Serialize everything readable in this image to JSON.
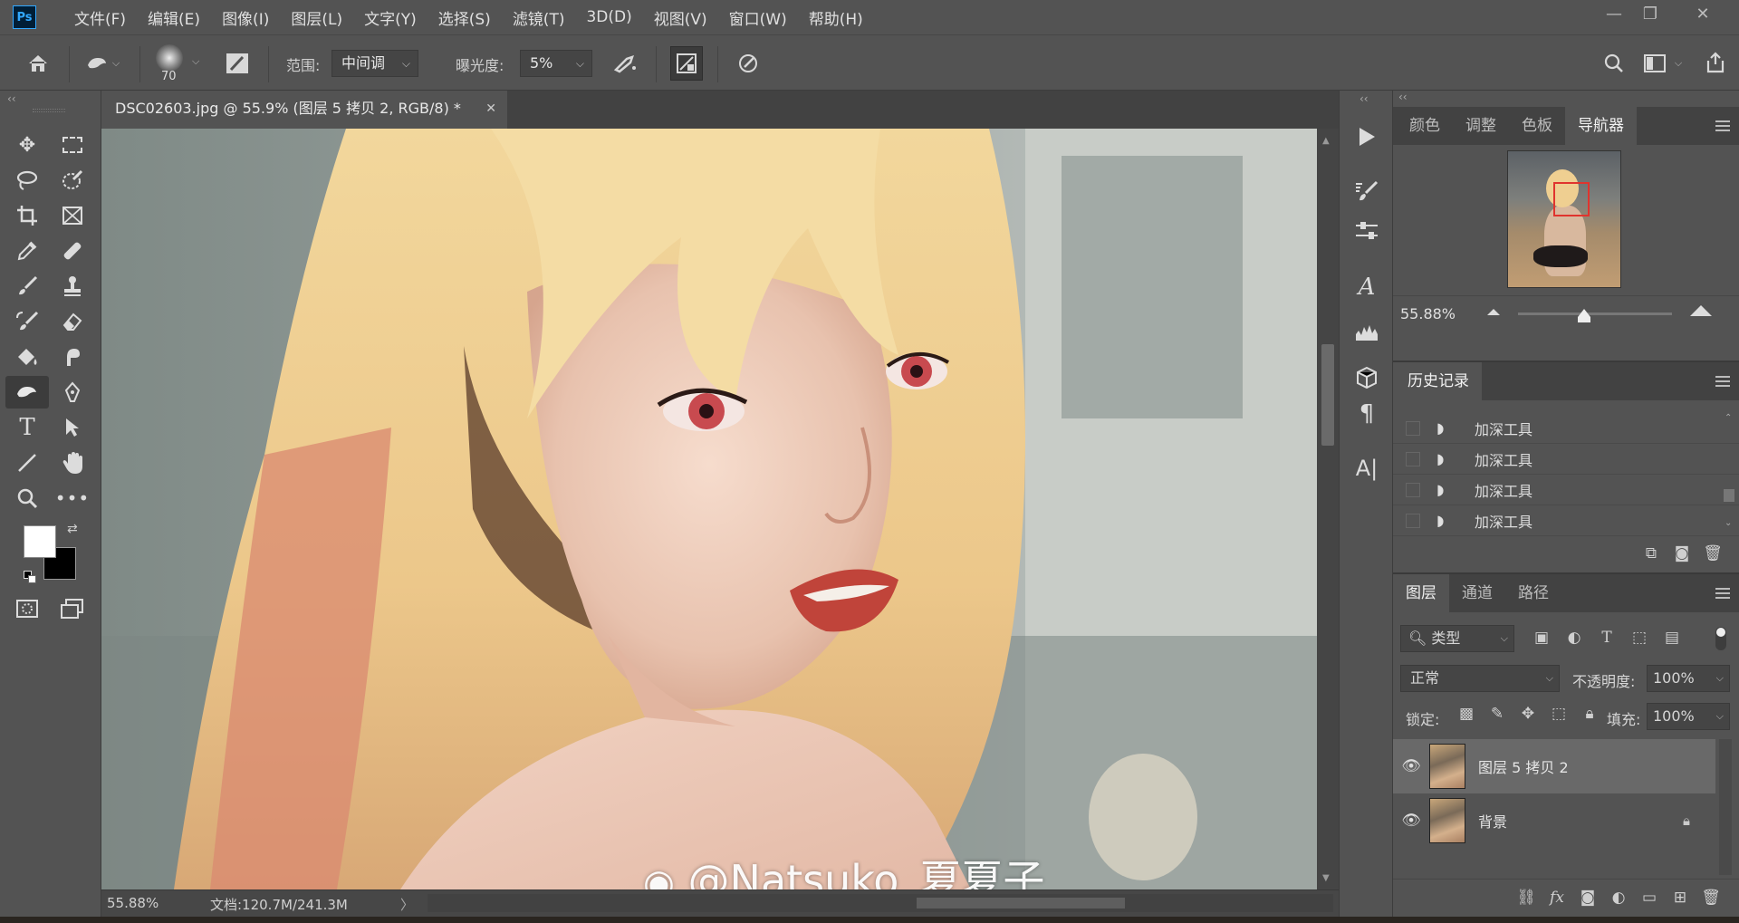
{
  "app": {
    "logo": "Ps"
  },
  "menu": [
    "文件(F)",
    "编辑(E)",
    "图像(I)",
    "图层(L)",
    "文字(Y)",
    "选择(S)",
    "滤镜(T)",
    "3D(D)",
    "视图(V)",
    "窗口(W)",
    "帮助(H)"
  ],
  "window_controls": {
    "minimize": "—",
    "restore": "❐",
    "close": "✕"
  },
  "options": {
    "brush_size": "70",
    "range_label": "范围:",
    "range_value": "中间调",
    "exposure_label": "曝光度:",
    "exposure_value": "5%"
  },
  "document": {
    "tab_title": "DSC02603.jpg @ 55.9% (图层 5 拷贝 2, RGB/8) *",
    "close": "✕",
    "zoom": "55.88%",
    "doc_size": "文档:120.7M/241.3M",
    "status_arrow": "〉",
    "watermark": "@Natsuko_夏夏子"
  },
  "navigator": {
    "tabs": [
      "颜色",
      "调整",
      "色板",
      "导航器"
    ],
    "active_tab": "导航器",
    "zoom": "55.88%"
  },
  "history": {
    "tab": "历史记录",
    "items": [
      "加深工具",
      "加深工具",
      "加深工具",
      "加深工具"
    ]
  },
  "layers": {
    "tabs": [
      "图层",
      "通道",
      "路径"
    ],
    "active_tab": "图层",
    "filter_label": "类型",
    "blend_mode": "正常",
    "opacity_label": "不透明度:",
    "opacity_value": "100%",
    "lock_label": "锁定:",
    "fill_label": "填充:",
    "fill_value": "100%",
    "items": [
      {
        "name": "图层 5 拷贝 2",
        "selected": true
      },
      {
        "name": "背景",
        "selected": false
      }
    ]
  },
  "colors": {
    "foreground": "#ffffff",
    "background": "#000000",
    "accent": "#31a8ff"
  }
}
